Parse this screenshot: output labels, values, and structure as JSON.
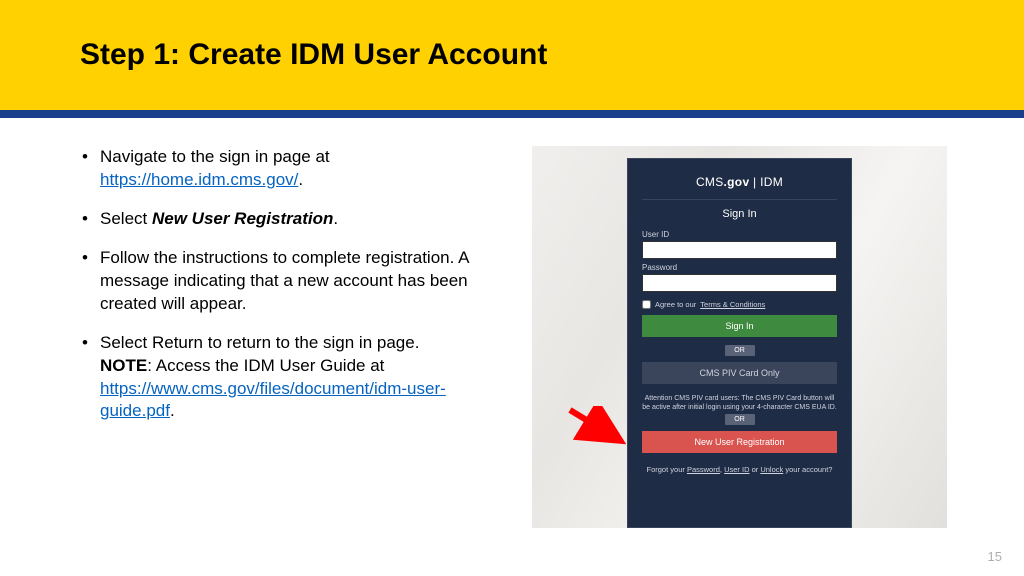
{
  "header": {
    "title": "Step 1: Create IDM User Account"
  },
  "bullets": {
    "b1_pre": "Navigate to the sign in page at ",
    "b1_link": "https://home.idm.cms.gov/",
    "b1_post": ".",
    "b2_pre": "Select ",
    "b2_bold": "New User Registration",
    "b2_post": ".",
    "b3": "Follow the instructions to complete registration. A message indicating that a new account has been created will appear.",
    "b4_pre": "Select Return to return to the sign in page. ",
    "b4_note": "NOTE",
    "b4_mid": ": Access the IDM User Guide at ",
    "b4_link": "https://www.cms.gov/files/document/idm-user-guide.pdf",
    "b4_post": "."
  },
  "panel": {
    "logo_left": "CMS",
    "logo_gov": ".gov",
    "logo_sep": " | ",
    "logo_right": "IDM",
    "title": "Sign In",
    "userid_label": "User ID",
    "userid_value": "",
    "password_label": "Password",
    "agree_pre": "Agree to our ",
    "agree_tc": "Terms & Conditions",
    "signin_btn": "Sign In",
    "or": "OR",
    "piv_btn": "CMS PIV Card Only",
    "piv_note": "Attention CMS PIV card users: The CMS PIV Card button will be active after initial login using your 4-character CMS EUA ID.",
    "or2": "OR",
    "register_btn": "New User Registration",
    "forgot_pre": "Forgot your ",
    "forgot_pw": "Password",
    "forgot_sep1": ", ",
    "forgot_uid": "User ID",
    "forgot_sep2": " or ",
    "forgot_unlock": "Unlock",
    "forgot_post": " your account?"
  },
  "pageNumber": "15"
}
